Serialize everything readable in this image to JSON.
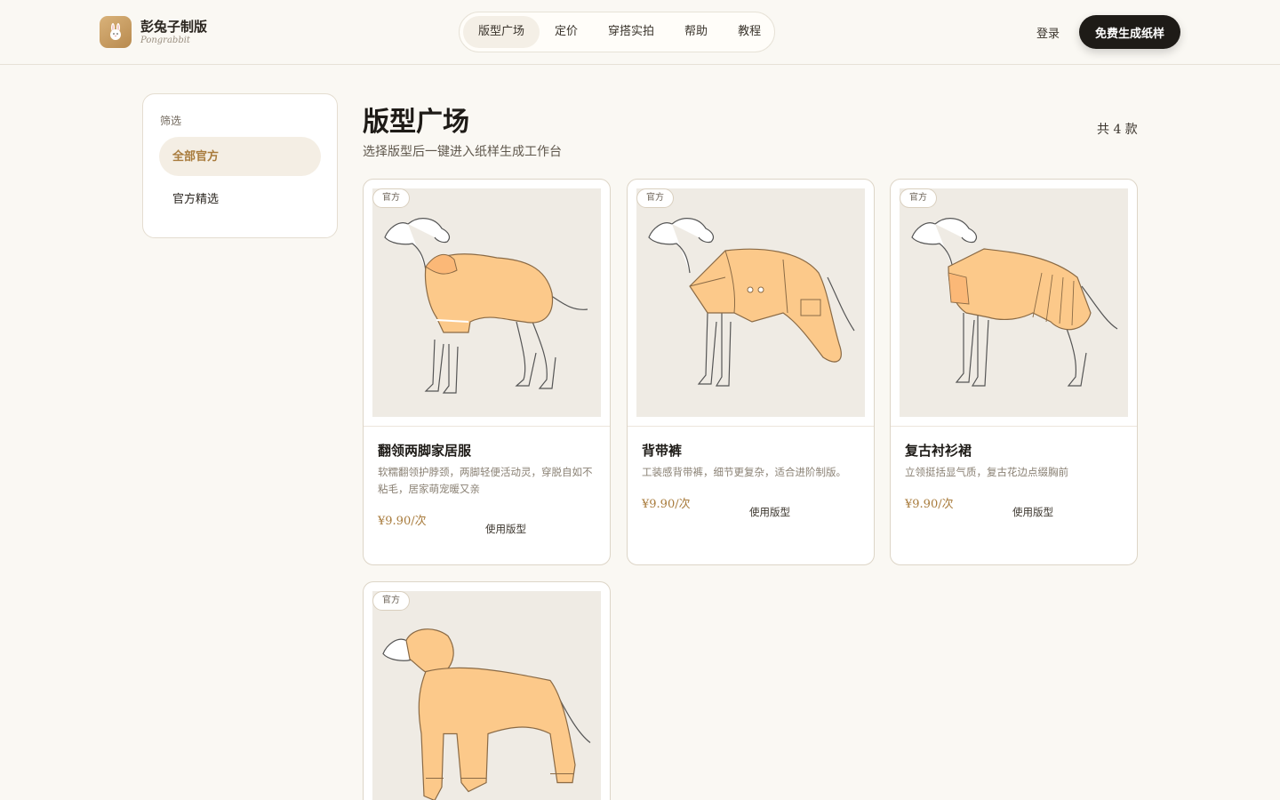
{
  "header": {
    "brand_name": "彭兔子制版",
    "brand_sub": "Pongrabbit",
    "nav": [
      {
        "label": "版型广场",
        "active": true
      },
      {
        "label": "定价",
        "active": false
      },
      {
        "label": "穿搭实拍",
        "active": false
      },
      {
        "label": "帮助",
        "active": false
      },
      {
        "label": "教程",
        "active": false
      }
    ],
    "login_label": "登录",
    "cta_label": "免费生成纸样"
  },
  "sidebar": {
    "title": "筛选",
    "items": [
      {
        "label": "全部官方",
        "active": true
      },
      {
        "label": "官方精选",
        "active": false
      }
    ]
  },
  "main": {
    "title": "版型广场",
    "subtitle": "选择版型后一键进入纸样生成工作台",
    "count": "共 4 款",
    "cards": [
      {
        "badge": "官方",
        "title": "翻领两脚家居服",
        "desc": "软糯翻领护脖颈，两脚轻便活动灵，穿脱自如不粘毛，居家萌宠暖又亲",
        "price": "¥9.90/次",
        "use_label": "使用版型"
      },
      {
        "badge": "官方",
        "title": "背带裤",
        "desc": "工装感背带裤，细节更复杂，适合进阶制版。",
        "price": "¥9.90/次",
        "use_label": "使用版型"
      },
      {
        "badge": "官方",
        "title": "复古衬衫裙",
        "desc": "立领挺括显气质，复古花边点缀胸前",
        "price": "¥9.90/次",
        "use_label": "使用版型"
      },
      {
        "badge": "官方",
        "title": "",
        "desc": "",
        "price": "",
        "use_label": ""
      }
    ]
  },
  "colors": {
    "background": "#faf8f3",
    "accent": "#a87b3c",
    "garment": "#fcc98a",
    "cta": "#1e1b17"
  }
}
